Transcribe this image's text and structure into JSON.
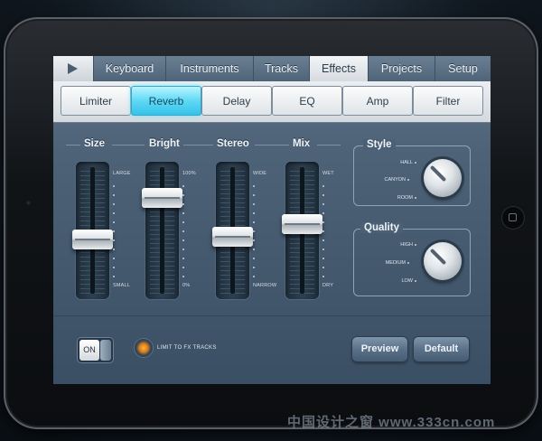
{
  "tabs": [
    {
      "label": "Keyboard"
    },
    {
      "label": "Instruments"
    },
    {
      "label": "Tracks"
    },
    {
      "label": "Effects"
    },
    {
      "label": "Projects"
    },
    {
      "label": "Setup"
    }
  ],
  "active_tab": "Effects",
  "effects": [
    {
      "label": "Limiter"
    },
    {
      "label": "Reverb"
    },
    {
      "label": "Delay"
    },
    {
      "label": "EQ"
    },
    {
      "label": "Amp"
    },
    {
      "label": "Filter"
    }
  ],
  "active_effect": "Reverb",
  "faders": [
    {
      "label": "Size",
      "top_mark": "LARGE",
      "bottom_mark": "SMALL",
      "level": 0.42
    },
    {
      "label": "Bright",
      "top_mark": "100%",
      "bottom_mark": "0%",
      "level": 0.78
    },
    {
      "label": "Stereo",
      "top_mark": "WIDE",
      "bottom_mark": "NARROW",
      "level": 0.45
    },
    {
      "label": "Mix",
      "top_mark": "WET",
      "bottom_mark": "DRY",
      "level": 0.55
    }
  ],
  "style_panel": {
    "title": "Style",
    "options": [
      "HALL",
      "CANYON",
      "ROOM"
    ],
    "selected": "CANYON"
  },
  "quality_panel": {
    "title": "Quality",
    "options": [
      "HIGH",
      "MEDIUM",
      "LOW"
    ],
    "selected": "MEDIUM"
  },
  "toggle": {
    "label": "ON"
  },
  "limit_label": "LIMIT TO FX TRACKS",
  "buttons": {
    "preview": "Preview",
    "default": "Default"
  },
  "watermark": "中国设计之窗 www.333cn.com",
  "colors": {
    "accent": "#35c2ea",
    "led": "#ffb347"
  }
}
